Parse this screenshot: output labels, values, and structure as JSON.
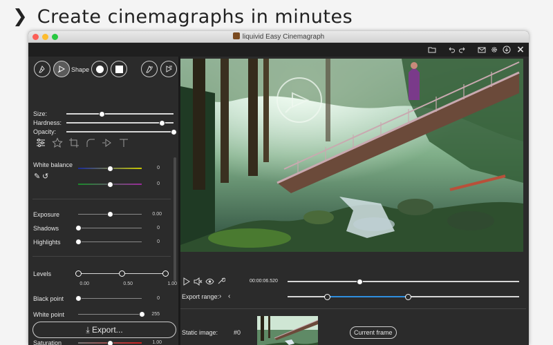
{
  "promo": {
    "arrow": "❯",
    "headline": "Create cinemagraphs in minutes"
  },
  "window": {
    "title": "liquivid Easy Cinemagraph"
  },
  "toolbar": {
    "icons": [
      "folder-icon",
      "undo-icon",
      "redo-icon",
      "mail-icon",
      "gear-icon",
      "download-icon",
      "close-icon"
    ],
    "close_glyph": "×"
  },
  "brush": {
    "shape_label": "Shape",
    "size_label": "Size:",
    "hardness_label": "Hardness:",
    "opacity_label": "Opacity:",
    "size": 0.33,
    "hardness": 0.89,
    "opacity": 1.0
  },
  "adjust": {
    "white_balance_label": "White balance",
    "wb1_value": "0",
    "wb2_value": "0",
    "exposure_label": "Exposure",
    "exposure_value": "0.00",
    "shadows_label": "Shadows",
    "shadows_value": "0",
    "highlights_label": "Highlights",
    "highlights_value": "0",
    "levels_label": "Levels",
    "levels_low": "0.00",
    "levels_mid": "0.50",
    "levels_high": "1.00",
    "black_point_label": "Black point",
    "black_point_value": "0",
    "white_point_label": "White point",
    "white_point_value": "255",
    "saturation_label": "Saturation",
    "saturation_value": "1.00"
  },
  "export_button": "Export...",
  "playback": {
    "timecode": "00:00:06.520",
    "position": 0.31,
    "export_range_label": "Export range:",
    "range_start": 0.17,
    "range_end": 0.52
  },
  "static_image": {
    "label": "Static image:",
    "frame": "#0",
    "current_frame_button": "Current frame"
  },
  "colors": {
    "range_fill": "#2f8fe0",
    "panel_bg": "#2b2b2b",
    "toolbar_bg": "#1f1f1f"
  }
}
